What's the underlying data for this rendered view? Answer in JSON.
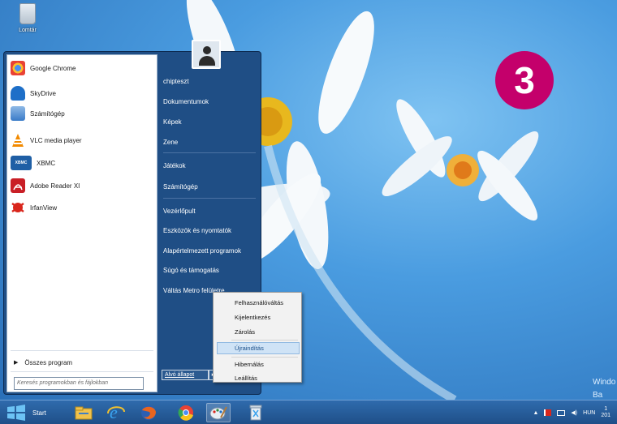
{
  "desktop": {
    "recycle_bin_label": "Lomtár",
    "step_badge": "3",
    "watermark_lines": [
      "Windo",
      "Ba"
    ]
  },
  "start_menu": {
    "programs": [
      {
        "label": "Google Chrome",
        "icon": "chrome-icon",
        "color": "#e94235"
      },
      {
        "label": "SkyDrive",
        "icon": "skydrive-icon",
        "color": "#1e6fc8"
      },
      {
        "label": "Számítógép",
        "icon": "computer-icon",
        "color": "#3a7bc8"
      },
      {
        "label": "VLC media player",
        "icon": "vlc-icon",
        "color": "#f28a00"
      },
      {
        "label": "XBMC",
        "icon": "xbmc-icon",
        "color": "#1f5fa5",
        "icon_text": "XBMC"
      },
      {
        "label": "Adobe Reader XI",
        "icon": "adobe-reader-icon",
        "color": "#c91f26"
      },
      {
        "label": "IrfanView",
        "icon": "irfanview-icon",
        "color": "#d9261c"
      }
    ],
    "all_programs_label": "Összes program",
    "search_placeholder": "Keresés programokban és fájlokban",
    "places": [
      "chipteszt",
      "Dokumentumok",
      "Képek",
      "Zene",
      "Játékok",
      "Számítógép",
      "Vezérlőpult",
      "Eszközök és nyomtatók",
      "Alapértelmezett programok",
      "Súgó és támogatás",
      "Váltás Metro felületre"
    ],
    "shutdown_label": "Alvó állapot",
    "shutdown_arrow": "▸"
  },
  "power_menu": {
    "items": [
      {
        "label": "Felhasználóváltás",
        "highlighted": false
      },
      {
        "label": "Kijelentkezés",
        "highlighted": false
      },
      {
        "label": "Zárolás",
        "highlighted": false
      },
      {
        "label": "Újraindítás",
        "highlighted": true
      },
      {
        "label": "Hibernálás",
        "highlighted": false
      },
      {
        "label": "Leállítás",
        "highlighted": false
      }
    ]
  },
  "taskbar": {
    "start_label": "Start",
    "pinned": [
      "file-explorer-icon",
      "internet-explorer-icon",
      "firefox-icon",
      "chrome-icon",
      "paint-icon",
      "recycle-icon"
    ],
    "tray": {
      "language": "HUN",
      "clock_fragment": "1",
      "date_fragment": "201"
    }
  },
  "colors": {
    "badge": "#c4006b",
    "menu_blue": "#1f4e85",
    "highlight": "#cfe3f6"
  }
}
